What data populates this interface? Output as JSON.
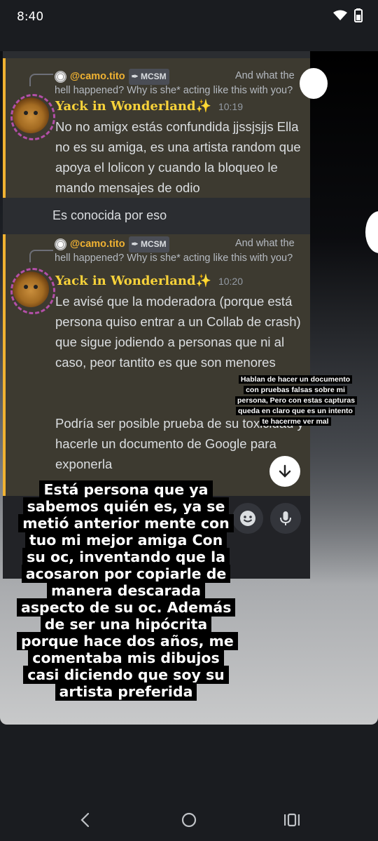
{
  "status_bar": {
    "time": "8:40",
    "icons": [
      "wifi-icon",
      "battery-icon"
    ]
  },
  "discord": {
    "messages": [
      {
        "reply_user": "@camo.tito",
        "reply_tag": "MCSM",
        "reply_text": "And what the hell happened? Why is she* acting like this with you?",
        "author": "Yack in Wonderland✨",
        "time": "10:19",
        "body": "No no amigx estás confundida jjssjsjjs Ella no es su amiga, es una artista random que apoya el lolicon y cuando la bloqueo le mando mensajes de odio"
      },
      {
        "reply_user": "@camo.tito",
        "reply_tag": "MCSM",
        "reply_text": "And what the hell happened? Why is she* acting like this with you?",
        "author": "Yack in Wonderland✨",
        "time": "10:20",
        "body": "Le avisé que la moderadora (porque está persona quiso entrar a un Collab de crash) que sigue jodiendo a personas que ni al caso, peor tantito es que son menores",
        "body2": "Podría ser posible prueba de su toxicidad y hacerle un documento de Google para exponerla"
      }
    ],
    "followup": "Es conocida por eso"
  },
  "captions": {
    "small": "Hablan de hacer un documento con pruebas falsas sobre mi persona, Pero con estas capturas queda en claro que es un intento te hacerme ver mal",
    "big": "Está persona que ya sabemos quién es, ya se metió anterior mente con tuo mi mejor amiga Con su oc, inventando que la acosaron por copiarle de manera descarada aspecto de su oc. Además de ser una hipócrita porque hace dos años, me comentaba mis dibujos casi diciendo que soy su artista preferida"
  },
  "nav": {
    "icons": [
      "back-icon",
      "home-icon",
      "recents-icon"
    ]
  },
  "colors": {
    "accent": "#f0b232",
    "author": "#f7d23a",
    "background": "#1a1c20"
  }
}
